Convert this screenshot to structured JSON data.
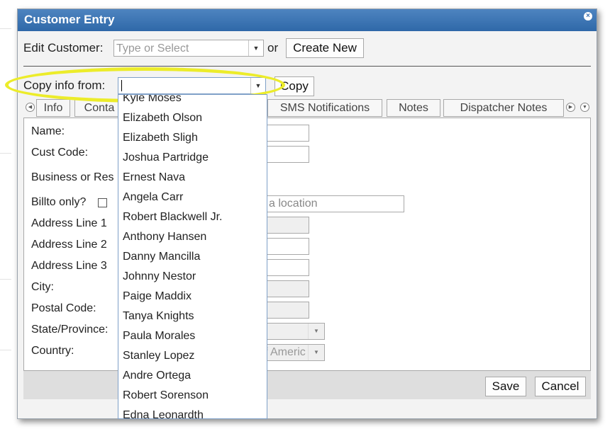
{
  "dialog": {
    "title": "Customer Entry",
    "close_glyph": "×"
  },
  "edit_customer": {
    "label": "Edit Customer:",
    "placeholder": "Type or Select",
    "or_label": "or",
    "create_button": "Create New"
  },
  "copy_info": {
    "label": "Copy info from:",
    "value": "",
    "copy_button": "Copy"
  },
  "tabs": [
    {
      "label": "Info"
    },
    {
      "label": "Conta"
    },
    {
      "label": "SMS Notifications"
    },
    {
      "label": "Notes"
    },
    {
      "label": "Dispatcher Notes"
    }
  ],
  "form": {
    "name_label": "Name:",
    "cust_code_label": "Cust Code:",
    "business_label": "Business or Res",
    "billto_label": "Billto only?",
    "location_placeholder": "a location",
    "address1_label": "Address Line 1",
    "address2_label": "Address Line 2",
    "address3_label": "Address Line 3",
    "city_label": "City:",
    "postal_label": "Postal Code:",
    "state_label": "State/Province:",
    "country_label": "Country:",
    "country_value": "f Americ"
  },
  "footer": {
    "save_button": "Save",
    "cancel_button": "Cancel"
  },
  "dropdown_items": [
    "Kyle Moses",
    "Elizabeth Olson",
    "Elizabeth Sligh",
    "Joshua Partridge",
    "Ernest Nava",
    "Angela Carr",
    "Robert Blackwell Jr.",
    "Anthony Hansen",
    "Danny Mancilla",
    "Johnny Nestor",
    "Paige Maddix",
    "Tanya Knights",
    "Paula Morales",
    "Stanley Lopez",
    "Andre Ortega",
    "Robert Sorenson",
    "Edna Leonardth"
  ],
  "colors": {
    "titlebar": "#3b72b3",
    "highlight": "#ecec2a"
  }
}
